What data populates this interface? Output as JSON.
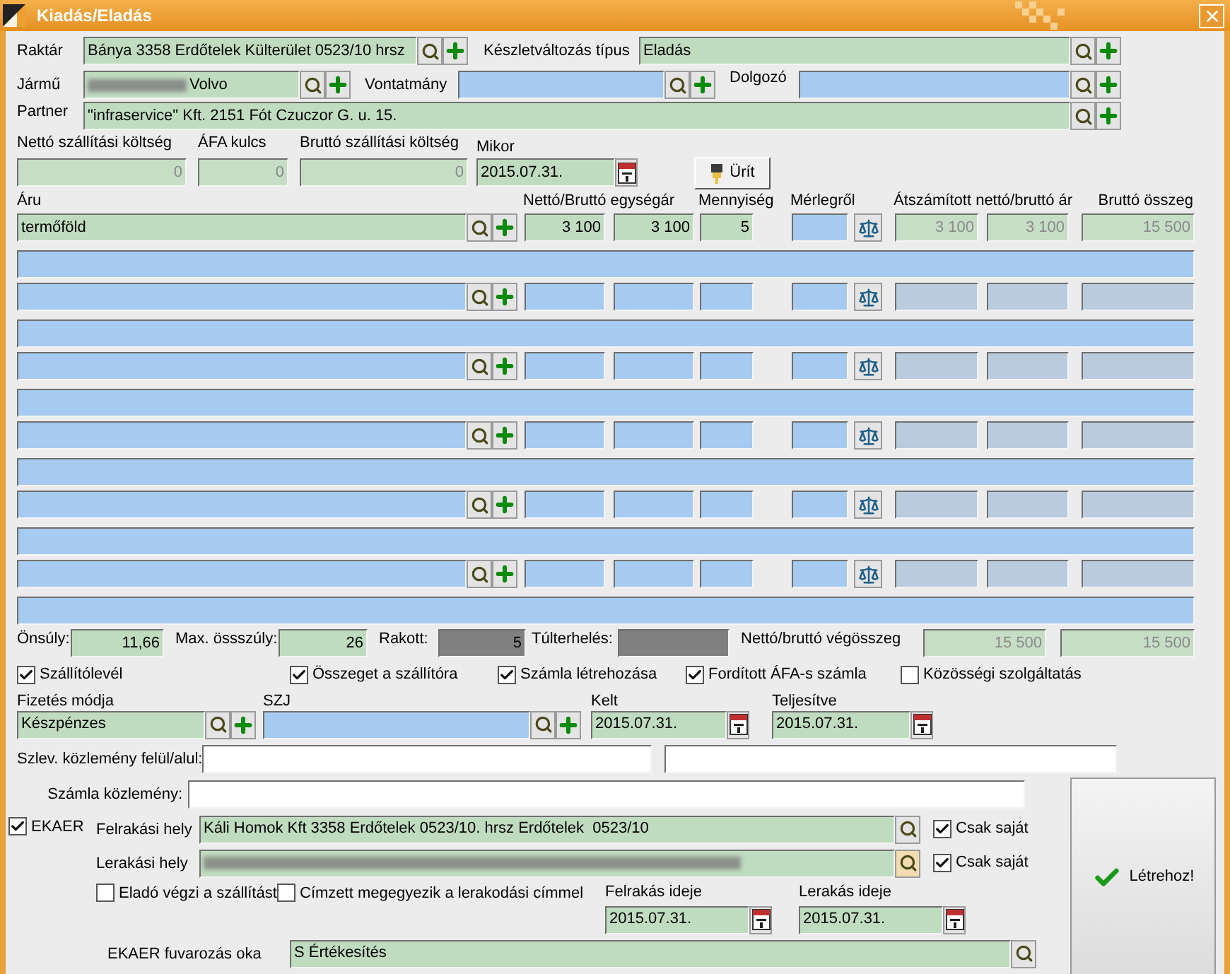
{
  "window": {
    "title": "Kiadás/Eladás"
  },
  "warehouse": {
    "label": "Raktár",
    "value": "Bánya 3358 Erdőtelek Külterület 0523/10 hrsz"
  },
  "stock_change_type": {
    "label": "Készletváltozás típus",
    "value": "Eladás"
  },
  "vehicle": {
    "label": "Jármű",
    "value": "Volvo",
    "blurred": true
  },
  "trailer": {
    "label": "Vontatmány"
  },
  "employee": {
    "label": "Dolgozó"
  },
  "partner": {
    "label": "Partner",
    "value": "\"infraservice\" Kft. 2151 Fót Czuczor G. u. 15."
  },
  "costs": [
    {
      "label": "Nettó szállítási költség",
      "value": "0",
      "disabled": true
    },
    {
      "label": "ÁFA kulcs",
      "value": "0",
      "disabled": true
    },
    {
      "label": "Bruttó szállítási költség",
      "value": "0",
      "disabled": true
    }
  ],
  "when": {
    "label": "Mikor",
    "value": "2015.07.31."
  },
  "clear_button": {
    "label": "Ürít"
  },
  "item_columns": [
    {
      "label": "Áru",
      "disabled": false
    },
    {
      "label": "Nettó/Bruttó egységár",
      "disabled": false
    },
    {
      "label": "Mennyiség",
      "disabled": false
    },
    {
      "label": "Mérlegről",
      "disabled": false
    },
    {
      "label": "Átszámított nettó/bruttó ár",
      "disabled": true
    },
    {
      "label": "Bruttó összeg",
      "disabled": true
    }
  ],
  "items": [
    {
      "filled": true,
      "product": "termőföld",
      "net_unit": "3 100",
      "gross_unit": "3 100",
      "quantity": "5",
      "net_converted": "3 100",
      "gross_converted": "3 100",
      "gross_total": "15 500"
    },
    {
      "filled": false
    },
    {
      "filled": false
    },
    {
      "filled": false
    },
    {
      "filled": false
    },
    {
      "filled": false
    }
  ],
  "summary": [
    {
      "label": "Önsúly:",
      "value": "11,66",
      "color": "#c0dcc0"
    },
    {
      "label": "Max. össszúly:",
      "value": "26",
      "color": "#c0dcc0"
    },
    {
      "label": "Rakott:",
      "value": "5",
      "color": "#808080"
    },
    {
      "label": "Túlterhelés:",
      "color": "#808080"
    }
  ],
  "grand_total": {
    "label": "Nettó/bruttó végösszeg",
    "net": "15 500",
    "gross": "15 500",
    "disabled": true
  },
  "options": [
    {
      "label": "Szállítólevél",
      "checked": true
    },
    {
      "label": "Összeget a szállítóra",
      "checked": true
    },
    {
      "label": "Számla létrehozása",
      "checked": true
    },
    {
      "label": "Fordított ÁFA-s számla",
      "checked": true
    },
    {
      "label": "Közösségi szolgáltatás",
      "checked": false
    }
  ],
  "payment_method": {
    "label": "Fizetés módja",
    "value": "Készpénzes"
  },
  "szj": {
    "label": "SZJ"
  },
  "issue_date": {
    "label": "Kelt",
    "value": "2015.07.31."
  },
  "fulfilment_date": {
    "label": "Teljesítve",
    "value": "2015.07.31."
  },
  "delivery_note_comment": {
    "label": "Szlev. közlemény felül/alul:"
  },
  "invoice_comment": {
    "label": "Számla közlemény:"
  },
  "ekaer": {
    "label": "EKAER",
    "checked": true,
    "loading_place": {
      "label": "Felrakási hely",
      "value": "Káli Homok Kft 3358 Erdőtelek 0523/10. hrsz Erdőtelek  0523/10",
      "own_only": {
        "label": "Csak saját",
        "checked": true
      }
    },
    "unloading_place": {
      "label": "Lerakási hely",
      "blurred": true,
      "own_only": {
        "label": "Csak saját",
        "checked": true
      }
    },
    "seller_transports": {
      "label": "Eladó végzi a szállítást",
      "checked": false
    },
    "same_address": {
      "label": "Címzett megegyezik a lerakodási címmel",
      "checked": false
    },
    "loading_time": {
      "label": "Felrakás ideje",
      "value": "2015.07.31."
    },
    "unloading_time": {
      "label": "Lerakás ideje",
      "value": "2015.07.31."
    },
    "reason": {
      "label": "EKAER fuvarozás oka",
      "value": "S Értékesítés"
    }
  },
  "create_button": {
    "label": "Létrehoz!"
  }
}
